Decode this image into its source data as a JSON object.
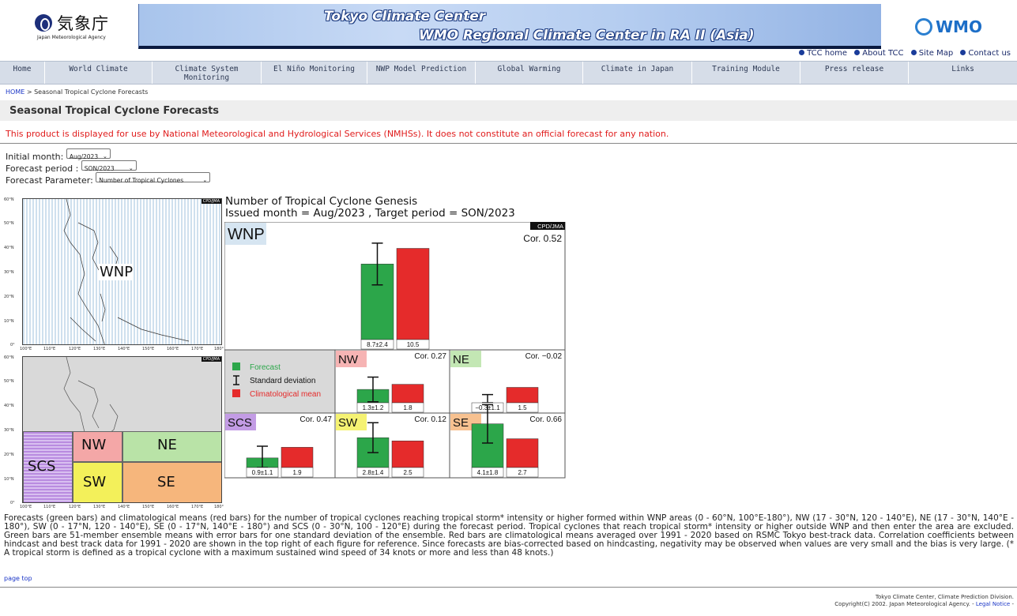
{
  "header": {
    "jma_name_jp": "気象庁",
    "jma_name_en": "Japan Meteorological Agency",
    "banner_line1": "Tokyo Climate Center",
    "banner_line2": "WMO Regional Climate Center in RA II (Asia)",
    "wmo_text": "WMO",
    "toplinks": [
      "TCC home",
      "About TCC",
      "Site Map",
      "Contact us"
    ]
  },
  "nav": {
    "items": [
      "Home",
      "World Climate",
      "Climate System Monitoring",
      "El Niño Monitoring",
      "NWP Model Prediction",
      "Global Warming",
      "Climate in Japan",
      "Training Module",
      "Press release",
      "Links"
    ]
  },
  "breadcrumb": {
    "home": "HOME",
    "separator": " > ",
    "current": "Seasonal Tropical Cyclone Forecasts"
  },
  "page_title": "Seasonal Tropical Cyclone Forecasts",
  "disclaimer": "This product is displayed for use by National Meteorological and Hydrological Services (NMHSs). It does not constitute an official forecast for any nation.",
  "controls": {
    "initial_month_label": "Initial month:",
    "initial_month_value": "Aug/2023",
    "forecast_period_label": "Forecast period :",
    "forecast_period_value": "SON/2023",
    "parameter_label": "Forecast Parameter:",
    "parameter_value": "Number of Tropical Cyclones"
  },
  "map": {
    "lat_labels": [
      "60°N",
      "50°N",
      "40°N",
      "30°N",
      "20°N",
      "10°N",
      "0°"
    ],
    "lon_labels": [
      "100°E",
      "110°E",
      "120°E",
      "130°E",
      "140°E",
      "150°E",
      "160°E",
      "170°E",
      "180°"
    ],
    "credit": "CPD/JMA",
    "regions": {
      "wnp": "WNP",
      "nw": "NW",
      "ne": "NE",
      "scs": "SCS",
      "sw": "SW",
      "se": "SE"
    },
    "colors": {
      "wnp": "#cfe0ee",
      "nw": "#f4a7a7",
      "ne": "#b9e3a7",
      "scs": "#b98be0",
      "sw": "#f3f05a",
      "se": "#f6b67c"
    }
  },
  "chart": {
    "title_line1": "Number of Tropical Cyclone Genesis",
    "title_line2": "Issued month = Aug/2023 , Target period = SON/2023",
    "credit": "CPD/JMA",
    "legend": {
      "forecast": "Forecast",
      "std": "Standard deviation",
      "clim": "Climatological mean"
    },
    "colors": {
      "forecast": "#2ca64a",
      "clim": "#e52b2b",
      "forecast_text": "#2ca64a",
      "clim_text": "#e52b2b"
    }
  },
  "chart_data": {
    "type": "bar",
    "panels": [
      {
        "region": "WNP",
        "corr": "Cor. 0.52",
        "forecast": 8.7,
        "sd": 2.4,
        "clim": 10.5,
        "forecast_label": "8.7±2.4",
        "clim_label": "10.5"
      },
      {
        "region": "NW",
        "corr": "Cor. 0.27",
        "forecast": 1.3,
        "sd": 1.2,
        "clim": 1.8,
        "forecast_label": "1.3±1.2",
        "clim_label": "1.8"
      },
      {
        "region": "NE",
        "corr": "Cor. −0.02",
        "forecast": -0.3,
        "sd": 1.1,
        "clim": 1.5,
        "forecast_label": "−0.3±1.1",
        "clim_label": "1.5"
      },
      {
        "region": "SCS",
        "corr": "Cor. 0.47",
        "forecast": 0.9,
        "sd": 1.1,
        "clim": 1.9,
        "forecast_label": "0.9±1.1",
        "clim_label": "1.9"
      },
      {
        "region": "SW",
        "corr": "Cor. 0.12",
        "forecast": 2.8,
        "sd": 1.4,
        "clim": 2.5,
        "forecast_label": "2.8±1.4",
        "clim_label": "2.5"
      },
      {
        "region": "SE",
        "corr": "Cor. 0.66",
        "forecast": 4.1,
        "sd": 1.8,
        "clim": 2.7,
        "forecast_label": "4.1±1.8",
        "clim_label": "2.7"
      }
    ]
  },
  "caption": "Forecasts (green bars) and climatological means (red bars) for the number of tropical cyclones reaching tropical storm* intensity or higher formed within WNP areas (0 - 60°N, 100°E-180°), NW (17 - 30°N, 120 - 140°E), NE (17 - 30°N, 140°E - 180°), SW (0 - 17°N, 120 - 140°E), SE (0 - 17°N, 140°E - 180°) and SCS (0 - 30°N, 100 - 120°E) during the forecast period. Tropical cyclones that reach tropical storm* intensity or higher outside WNP and then enter the area are excluded. Green bars are 51-member ensemble means with error bars for one standard deviation of the ensemble. Red bars are climatological means averaged over 1991 - 2020 based on RSMC Tokyo best-track data. Correlation coefficients between hindcast and best track data for 1991 - 2020 are shown in the top right of each figure for reference. Since forecasts are bias-corrected based on hindcasting, negativity may be observed when values are very small and the bias is very large. (* A tropical storm is defined as a tropical cyclone with a maximum sustained wind speed of 34 knots or more and less than 48 knots.)",
  "page_top": "page top",
  "footer": {
    "line1": "Tokyo Climate Center, Climate Prediction Division.",
    "line2": "Copyright(C) 2002. Japan Meteorological Agency. - ",
    "legal": "Legal Notice",
    "line2_end": " -"
  }
}
